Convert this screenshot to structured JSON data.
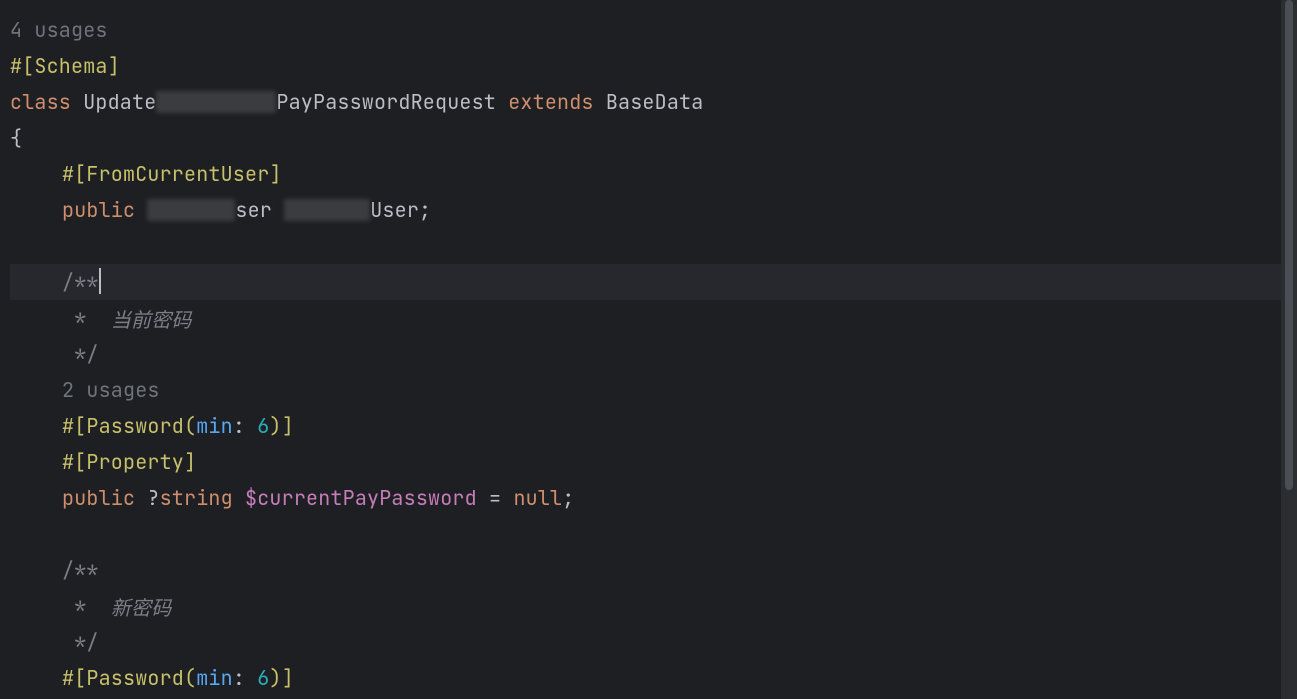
{
  "usages_top": "4 usages",
  "attr_schema": "#[Schema]",
  "kw_class": "class",
  "cls_prefix": "Update",
  "cls_suffix": "PayPasswordRequest",
  "kw_extends": "extends",
  "cls_base": "BaseData",
  "brace_open": "{",
  "attr_fromcurrent": "#[FromCurrentUser]",
  "kw_public": "public",
  "type_user_suffix": "ser",
  "var_user_suffix": "User",
  "semi": ";",
  "cmt_open": "/**",
  "cmt_star": " *",
  "cmt_cn_current": "当前密码",
  "cmt_close": " */",
  "usages_mid": "2 usages",
  "attr_password_open": "#[Password(",
  "attr_password_param": "min",
  "colon_sp": ": ",
  "attr_password_num": "6",
  "attr_password_close": ")]",
  "attr_property": "#[Property]",
  "type_nullable_string_q": "?",
  "type_nullable_string": "string",
  "var_current": "$currentPayPassword",
  "eq": " = ",
  "kw_null": "null",
  "cmt_cn_new": "新密码"
}
